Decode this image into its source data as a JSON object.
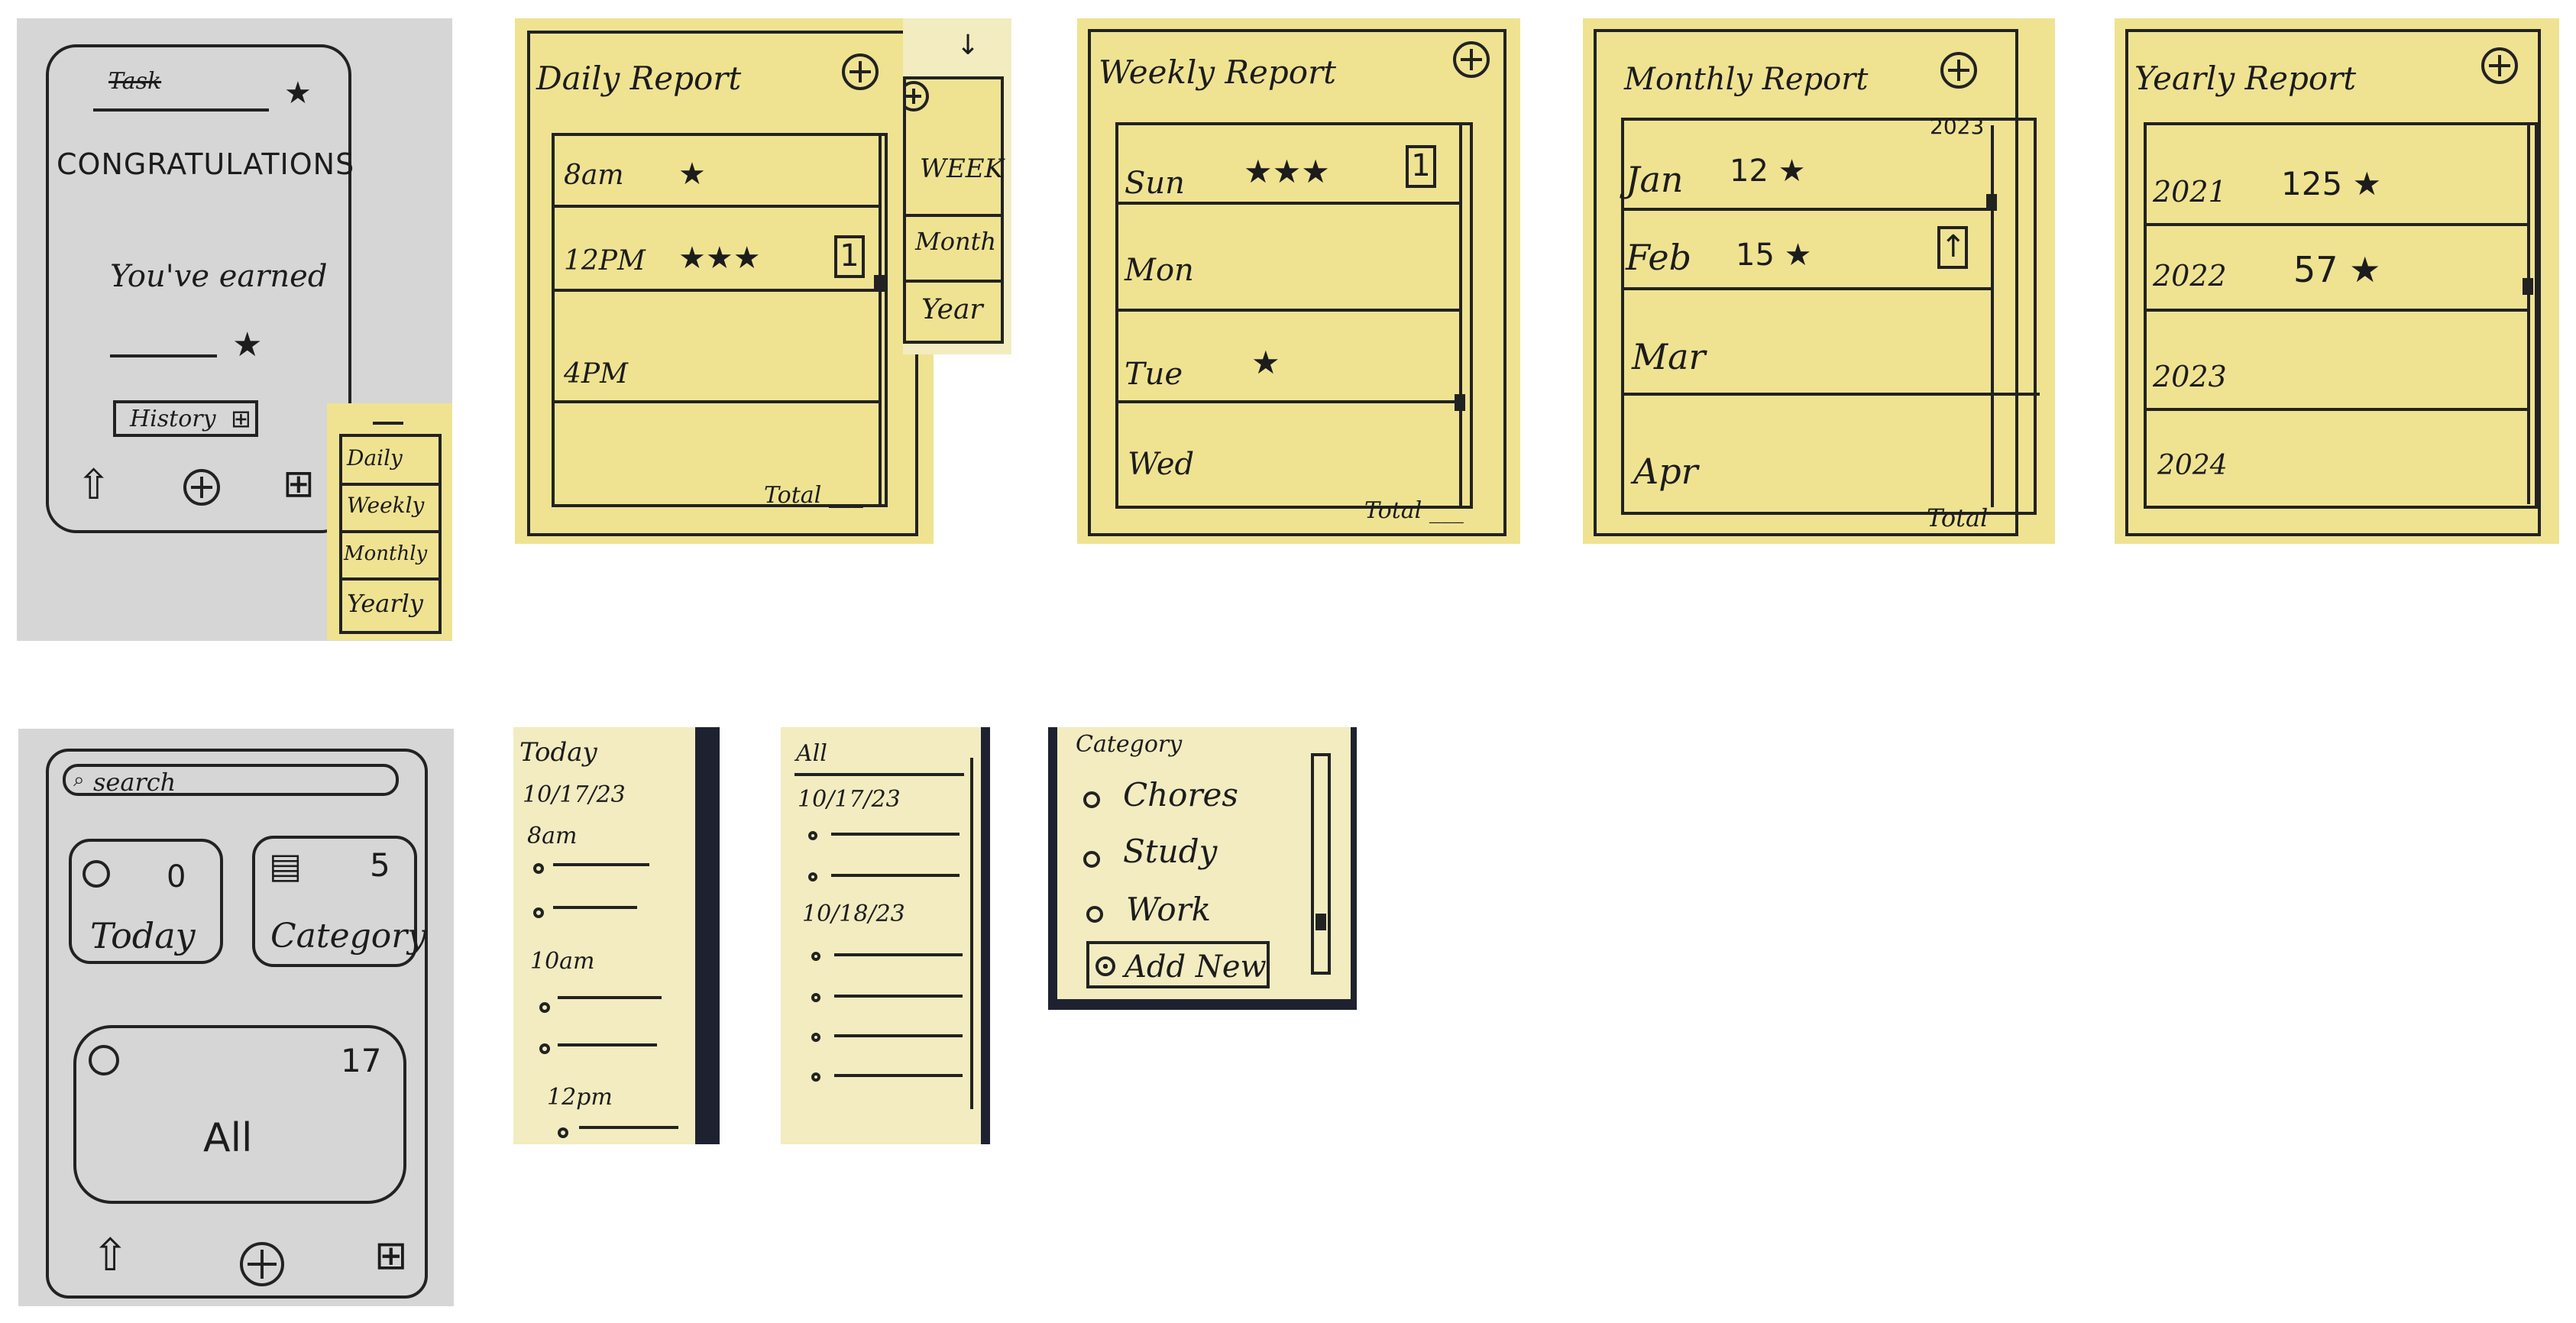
{
  "congrats": {
    "task_label": "Task",
    "headline": "CONGRATULATIONS",
    "earned": "You've earned",
    "history_button": "History",
    "star": "★",
    "nav": {
      "home": "⇧",
      "add": "+",
      "grid": "⊞"
    }
  },
  "history_menu": {
    "items": [
      "Daily",
      "Weekly",
      "Monthly",
      "Yearly"
    ]
  },
  "daily_report": {
    "title": "Daily Report",
    "rows": [
      {
        "label": "8am",
        "stars": "★"
      },
      {
        "label": "12PM",
        "stars": "★★★",
        "badge": "1"
      },
      {
        "label": "4PM",
        "stars": ""
      }
    ],
    "total": "Total ___"
  },
  "period_tab": {
    "items": [
      "WEEK",
      "Month",
      "Year"
    ]
  },
  "weekly_report": {
    "title": "Weekly Report",
    "rows": [
      {
        "label": "Sun",
        "stars": "★★★",
        "badge": "1"
      },
      {
        "label": "Mon",
        "stars": ""
      },
      {
        "label": "Tue",
        "stars": "★"
      },
      {
        "label": "Wed",
        "stars": ""
      }
    ],
    "total": "Total ___"
  },
  "monthly_report": {
    "title": "Monthly Report",
    "year": "2023",
    "rows": [
      {
        "label": "Jan",
        "value": "12 ★"
      },
      {
        "label": "Feb",
        "value": "15 ★",
        "badge": "↑"
      },
      {
        "label": "Mar",
        "value": ""
      },
      {
        "label": "Apr",
        "value": ""
      }
    ],
    "total": "Total"
  },
  "yearly_report": {
    "title": "Yearly Report",
    "rows": [
      {
        "label": "2021",
        "value": "125 ★"
      },
      {
        "label": "2022",
        "value": "57 ★"
      },
      {
        "label": "2023",
        "value": ""
      },
      {
        "label": "2024",
        "value": ""
      }
    ]
  },
  "home": {
    "search_placeholder": "search",
    "cards": {
      "today": {
        "label": "Today",
        "count": "0"
      },
      "category": {
        "label": "Category",
        "count": "5"
      },
      "all": {
        "label": "All",
        "count": "17"
      }
    },
    "nav": {
      "home": "⇧",
      "add": "+",
      "grid": "⊞"
    }
  },
  "today_list": {
    "title": "Today",
    "date": "10/17/23",
    "groups": [
      {
        "time": "8am"
      },
      {
        "time": "10am"
      },
      {
        "time": "12pm"
      }
    ]
  },
  "all_list": {
    "title": "All",
    "dates": [
      "10/17/23",
      "10/18/23"
    ]
  },
  "category_list": {
    "title": "Category",
    "items": [
      "Chores",
      "Study",
      "Work"
    ],
    "add_new": "Add New"
  }
}
